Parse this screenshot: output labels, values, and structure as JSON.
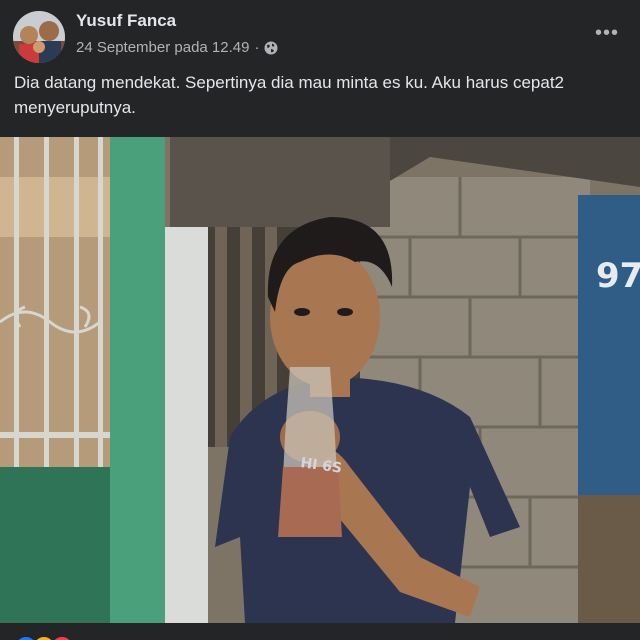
{
  "post": {
    "author": "Yusuf Fanca",
    "timestamp": "24 September pada 12.49",
    "separator": "·",
    "privacy_icon": "globe-icon",
    "more_icon": "more-horizontal-icon",
    "more_label": "•••",
    "caption": "Dia datang mendekat. Sepertinya dia mau minta es ku. Aku harus cepat2 menyeruputnya.",
    "photo_number": "97"
  },
  "reactions": {
    "icons": [
      "like-reaction-icon",
      "haha-reaction-icon",
      "love-reaction-icon"
    ],
    "colors": [
      "#2078f4",
      "#f7b125",
      "#f33e58"
    ]
  },
  "colors": {
    "background": "#242526",
    "primary_text": "#e4e6eb",
    "secondary_text": "#b0b3b8"
  }
}
